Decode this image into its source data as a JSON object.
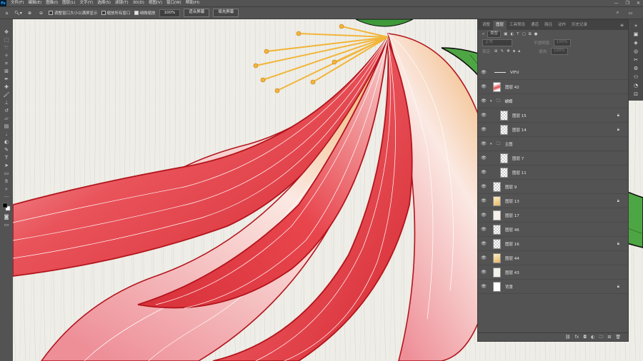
{
  "app": {
    "logo": "Ps"
  },
  "menu": [
    "文件(F)",
    "编辑(E)",
    "图像(I)",
    "图层(L)",
    "文字(Y)",
    "选择(S)",
    "滤镜(T)",
    "3D(D)",
    "视图(V)",
    "窗口(W)",
    "帮助(H)"
  ],
  "options": {
    "resize_windows": "调整窗口大小以满屏显示",
    "zoom_all": "缩放所有窗口",
    "scrubby_zoom": "细微缩放",
    "zoom_value": "100%",
    "fit_screen": "适合屏幕",
    "fill_screen": "填充屏幕"
  },
  "panel": {
    "tabs": [
      "调整",
      "图层",
      "工具预设",
      "通道",
      "路径",
      "动作",
      "历史记录"
    ],
    "active_tab": "图层",
    "filter_label": "类型",
    "blend_mode": "正常",
    "opacity_label": "不透明度:",
    "opacity_value": "100%",
    "lock_label": "锁定:",
    "fill_label": "填充:",
    "fill_value": "100%"
  },
  "layers": [
    {
      "name": "VIFU",
      "kind": "text"
    },
    {
      "name": "图层 42",
      "kind": "red"
    },
    {
      "name": "蝴蝶",
      "kind": "group"
    },
    {
      "name": "图层 15",
      "kind": "check",
      "locked": true,
      "indent": true
    },
    {
      "name": "图层 14",
      "kind": "check",
      "locked": true,
      "indent": true
    },
    {
      "name": "主图",
      "kind": "group"
    },
    {
      "name": "图层 7",
      "kind": "check",
      "indent": true
    },
    {
      "name": "图层 11",
      "kind": "check",
      "indent": true
    },
    {
      "name": "图层 9",
      "kind": "check"
    },
    {
      "name": "图层 13",
      "kind": "yel",
      "locked": true
    },
    {
      "name": "图层 17",
      "kind": "redline"
    },
    {
      "name": "图层 46",
      "kind": "check"
    },
    {
      "name": "图层 16",
      "kind": "check",
      "locked": true
    },
    {
      "name": "图层 44",
      "kind": "yel"
    },
    {
      "name": "图层 43",
      "kind": "pale"
    },
    {
      "name": "背景",
      "kind": "white",
      "locked": true
    }
  ],
  "colors": {
    "petal_red": "#e3343c",
    "petal_outline": "#b3151d",
    "stamen": "#f2b53a",
    "leaf": "#3f9a3a",
    "canvas_bg": "#eeede7"
  }
}
